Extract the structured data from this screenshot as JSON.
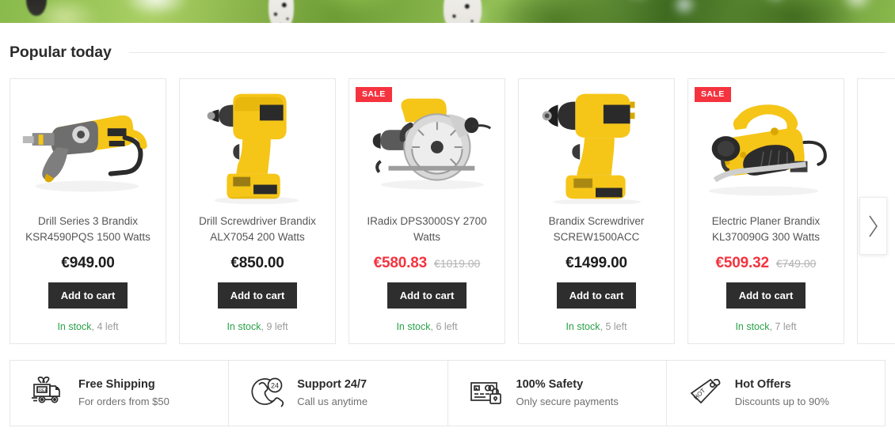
{
  "banner": {
    "alt": "foliage-hero-banner"
  },
  "section": {
    "title": "Popular today"
  },
  "carousel": {
    "next_label": "›",
    "sale_badge": "SALE",
    "add_to_cart": "Add to cart",
    "in_stock": "In stock",
    "products": [
      {
        "name": "Drill Series 3 Brandix KSR4590PQS 1500 Watts",
        "price": "€949.00",
        "old_price": "",
        "on_sale": false,
        "stock_label": "In stock",
        "stock_left": ", 4 left",
        "image": "hammer-drill"
      },
      {
        "name": "Drill Screwdriver Brandix ALX7054 200 Watts",
        "price": "€850.00",
        "old_price": "",
        "on_sale": false,
        "stock_label": "In stock",
        "stock_left": ", 9 left",
        "image": "cordless-drill"
      },
      {
        "name": "IRadix DPS3000SY 2700 Watts",
        "price": "€580.83",
        "old_price": "€1019.00",
        "on_sale": true,
        "stock_label": "In stock",
        "stock_left": ", 6 left",
        "image": "circular-saw"
      },
      {
        "name": "Brandix Screwdriver SCREW1500ACC",
        "price": "€1499.00",
        "old_price": "",
        "on_sale": false,
        "stock_label": "In stock",
        "stock_left": ", 5 left",
        "image": "compact-drill"
      },
      {
        "name": "Electric Planer Brandix KL370090G 300 Watts",
        "price": "€509.32",
        "old_price": "€749.00",
        "on_sale": true,
        "stock_label": "In stock",
        "stock_left": ", 7 left",
        "image": "electric-planer"
      }
    ]
  },
  "features": [
    {
      "icon": "free-shipping-truck-icon",
      "title": "Free Shipping",
      "subtitle": "For orders from $50"
    },
    {
      "icon": "support-24-phone-icon",
      "title": "Support 24/7",
      "subtitle": "Call us anytime"
    },
    {
      "icon": "secure-payment-card-lock-icon",
      "title": "100% Safety",
      "subtitle": "Only secure payments"
    },
    {
      "icon": "hot-offers-tag-icon",
      "title": "Hot Offers",
      "subtitle": "Discounts up to 90%"
    }
  ],
  "colors": {
    "sale_red": "#f5333f",
    "in_stock_green": "#29a148",
    "button_dark": "#2e2e2e",
    "border_gray": "#e7e7e7"
  }
}
